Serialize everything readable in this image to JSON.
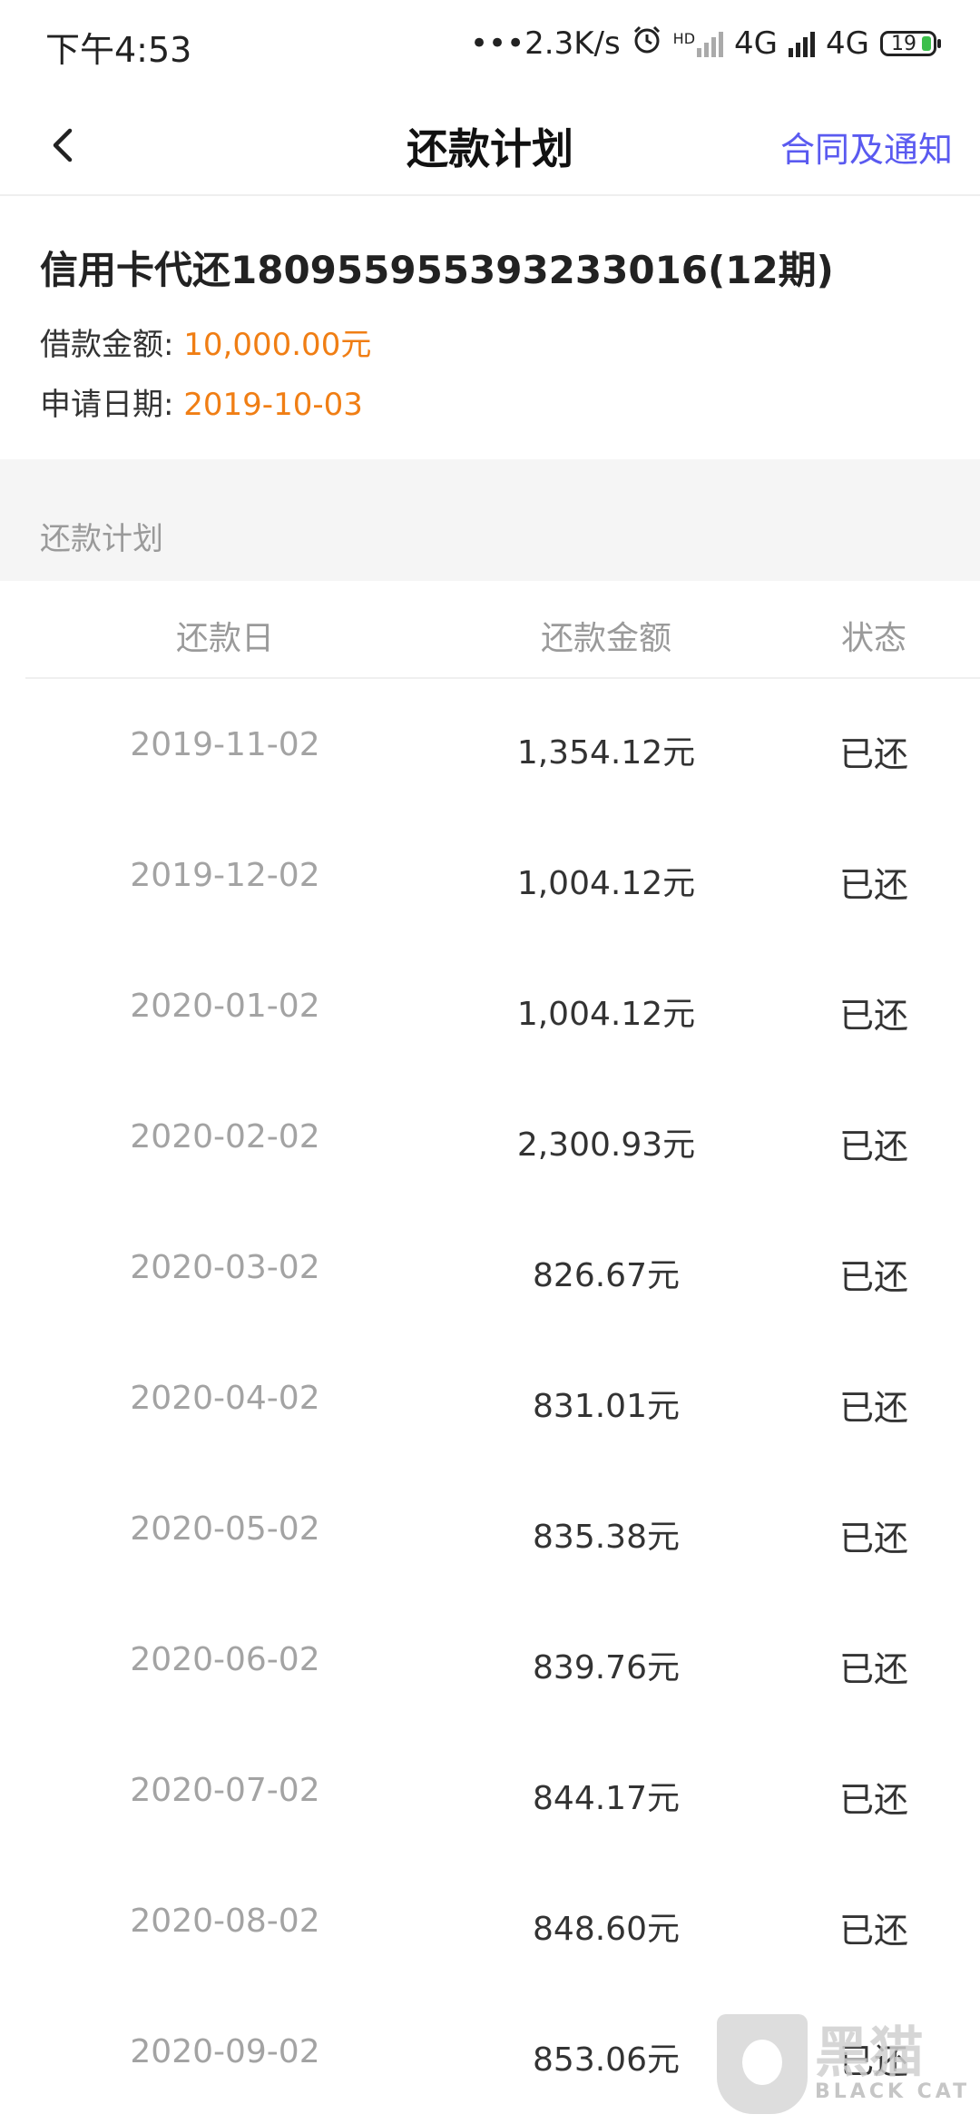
{
  "status_bar": {
    "time": "下午4:53",
    "network_speed": "•••2.3K/s",
    "hd_label": "HD",
    "network1": "4G",
    "network2": "4G",
    "battery": "19"
  },
  "navbar": {
    "title": "还款计划",
    "link": "合同及通知"
  },
  "loan": {
    "title": "信用卡代还180955955393233016(12期)",
    "amount_label": "借款金额:",
    "amount_value": "10,000.00元",
    "date_label": "申请日期:",
    "date_value": "2019-10-03"
  },
  "section": {
    "label": "还款计划"
  },
  "table": {
    "headers": [
      "还款日",
      "还款金额",
      "状态"
    ],
    "rows": [
      {
        "date": "2019-11-02",
        "amount": "1,354.12元",
        "status": "已还"
      },
      {
        "date": "2019-12-02",
        "amount": "1,004.12元",
        "status": "已还"
      },
      {
        "date": "2020-01-02",
        "amount": "1,004.12元",
        "status": "已还"
      },
      {
        "date": "2020-02-02",
        "amount": "2,300.93元",
        "status": "已还"
      },
      {
        "date": "2020-03-02",
        "amount": "826.67元",
        "status": "已还"
      },
      {
        "date": "2020-04-02",
        "amount": "831.01元",
        "status": "已还"
      },
      {
        "date": "2020-05-02",
        "amount": "835.38元",
        "status": "已还"
      },
      {
        "date": "2020-06-02",
        "amount": "839.76元",
        "status": "已还"
      },
      {
        "date": "2020-07-02",
        "amount": "844.17元",
        "status": "已还"
      },
      {
        "date": "2020-08-02",
        "amount": "848.60元",
        "status": "已还"
      },
      {
        "date": "2020-09-02",
        "amount": "853.06元",
        "status": "已还"
      }
    ]
  },
  "watermark": {
    "cn": "黑猫",
    "en": "BLACK CAT"
  },
  "colors": {
    "accent_link": "#5a5af0",
    "value_orange": "#f07e14",
    "muted_text": "#9a9a9a",
    "section_bg": "#f5f5f5"
  },
  "icons": {
    "back": "chevron-left-icon",
    "alarm": "alarm-clock-icon",
    "signal": "signal-bars-icon",
    "battery": "battery-icon"
  }
}
